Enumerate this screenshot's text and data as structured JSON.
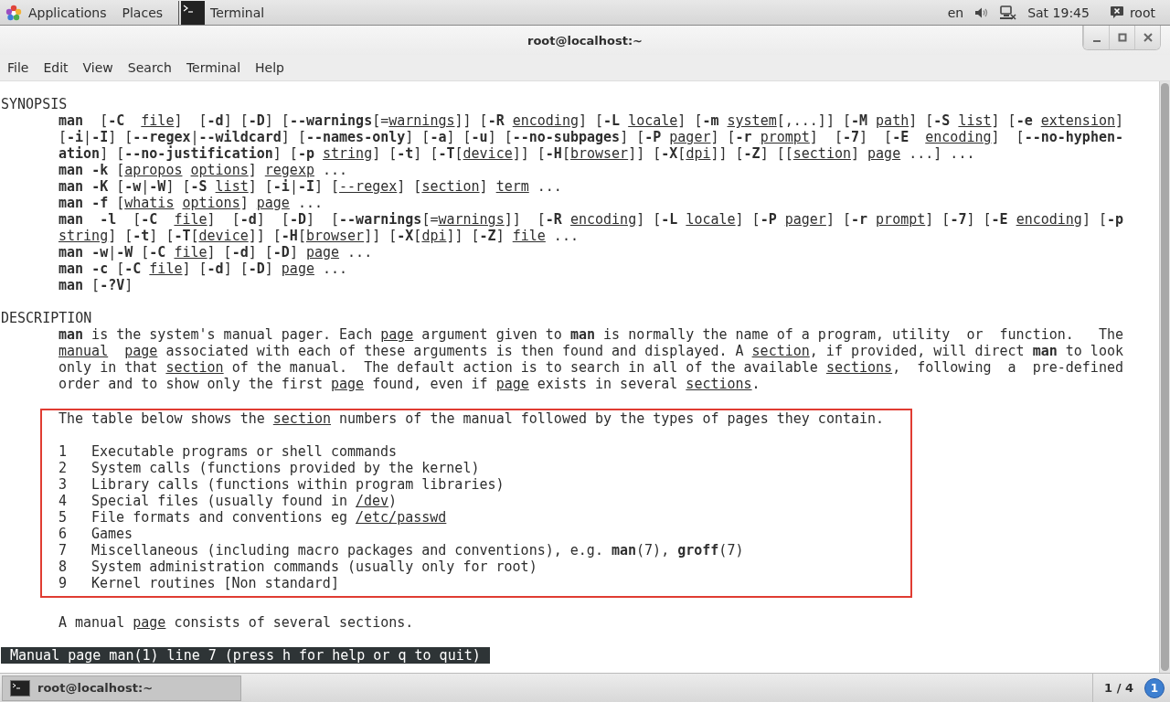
{
  "top_bar": {
    "menus": [
      {
        "label": "Applications"
      },
      {
        "label": "Places"
      }
    ],
    "task": {
      "label": "Terminal"
    },
    "language": "en",
    "clock": "Sat 19:45",
    "user": "root"
  },
  "window": {
    "title": "root@localhost:~",
    "menu": [
      "File",
      "Edit",
      "View",
      "Search",
      "Terminal",
      "Help"
    ]
  },
  "man_page": {
    "blocks": [
      {
        "kind": "heading",
        "text": "SYNOPSIS"
      },
      {
        "kind": "para",
        "lines": [
          "**man**  [**-C**  *file*]  [**-d**] [**-D**] [**--warnings**[=*warnings*]] [**-R** *encoding*] [**-L** *locale*] [**-m** *system*[,...]] [**-M** *path*] [**-S** *list*] [**-e** *extension*]",
          "[**-i**|**-I**] [**--regex**|**--wildcard**] [**--names-only**] [**-a**] [**-u**] [**--no-subpages**] [**-P** *pager*] [**-r** *prompt*]  [**-7**]  [**-E**  *encoding*]  [**--no-hyphen-**",
          "**ation**] [**--no-justification**] [**-p** *string*] [**-t**] [**-T**[*device*]] [**-H**[*browser*]] [**-X**[*dpi*]] [**-Z**] [[*section*] *page* ...] ...",
          "**man** **-k** [*apropos* *options*] *regexp* ...",
          "**man** **-K** [**-w**|**-W**] [**-S** *list*] [**-i**|**-I**] [*--regex*] [*section*] *term* ...",
          "**man** **-f** [*whatis* *options*] *page* ...",
          "**man**  **-l**  [**-C**  *file*]  [**-d**]  [**-D**]  [**--warnings**[=*warnings*]]  [**-R** *encoding*] [**-L** *locale*] [**-P** *pager*] [**-r** *prompt*] [**-7**] [**-E** *encoding*] [**-p**",
          "*string*] [**-t**] [**-T**[*device*]] [**-H**[*browser*]] [**-X**[*dpi*]] [**-Z**] *file* ...",
          "**man** **-w**|**-W** [**-C** *file*] [**-d**] [**-D**] *page* ...",
          "**man** **-c** [**-C** *file*] [**-d**] [**-D**] *page* ...",
          "**man** [**-?V**]"
        ]
      },
      {
        "kind": "heading",
        "text": "DESCRIPTION"
      },
      {
        "kind": "para",
        "lines": [
          "**man** is the system's manual pager. Each *page* argument given to **man** is normally the name of a program, utility  or  function.   The",
          "*manual*  *page* associated with each of these arguments is then found and displayed. A *section*, if provided, will direct **man** to look",
          "only in that *section* of the manual.  The default action is to search in all of the available *sections*,  following  a  pre-defined",
          "order and to show only the first *page* found, even if *page* exists in several *sections*."
        ]
      },
      {
        "kind": "highlight",
        "intro": "The table below shows the *section* numbers of the manual followed by the types of pages they contain.",
        "rows": [
          {
            "number": "1",
            "text": "Executable programs or shell commands"
          },
          {
            "number": "2",
            "text": "System calls (functions provided by the kernel)"
          },
          {
            "number": "3",
            "text": "Library calls (functions within program libraries)"
          },
          {
            "number": "4",
            "text": "Special files (usually found in */dev*)"
          },
          {
            "number": "5",
            "text": "File formats and conventions eg */etc/passwd*"
          },
          {
            "number": "6",
            "text": "Games"
          },
          {
            "number": "7",
            "text": "Miscellaneous (including macro packages and conventions), e.g. **man**(7), **groff**(7)"
          },
          {
            "number": "8",
            "text": "System administration commands (usually only for root)"
          },
          {
            "number": "9",
            "text": "Kernel routines [Non standard]"
          }
        ]
      },
      {
        "kind": "para",
        "lines": [
          "A manual *page* consists of several sections."
        ]
      }
    ]
  },
  "pager_status": "Manual page man(1) line 7 (press h for help or q to quit)",
  "taskbar": {
    "window": "root@localhost:~",
    "workspace": "1 / 4",
    "notifications": "1"
  }
}
